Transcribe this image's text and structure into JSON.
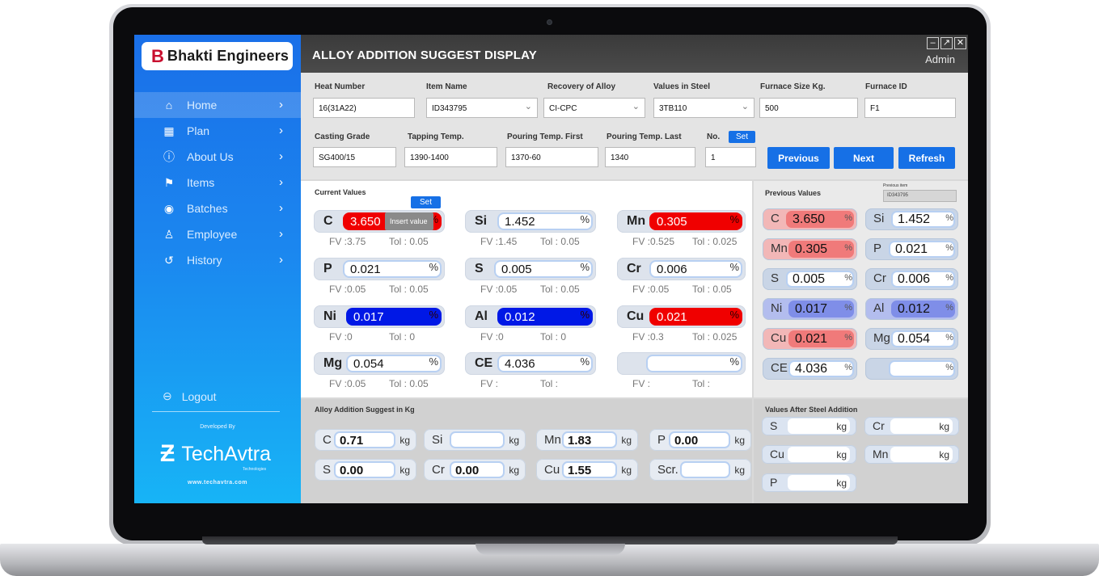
{
  "brand": {
    "b": "B",
    "name": "Bhakti Engineers"
  },
  "nav": [
    {
      "label": "Home",
      "icon": "home-icon",
      "glyph": "⌂"
    },
    {
      "label": "Plan",
      "icon": "plan-icon",
      "glyph": "▦"
    },
    {
      "label": "About Us",
      "icon": "info-icon",
      "glyph": "ⓘ"
    },
    {
      "label": "Items",
      "icon": "items-icon",
      "glyph": "⚑"
    },
    {
      "label": "Batches",
      "icon": "batches-icon",
      "glyph": "◉"
    },
    {
      "label": "Employee",
      "icon": "employee-icon",
      "glyph": "♙"
    },
    {
      "label": "History",
      "icon": "history-icon",
      "glyph": "↺"
    }
  ],
  "logout": "Logout",
  "developed_by": "Developed By",
  "techavtra": {
    "name": "TechAvtra",
    "sub": "Technologies",
    "web": "www.techavtra.com"
  },
  "header": {
    "title": "ALLOY ADDITION SUGGEST DISPLAY",
    "user": "Admin",
    "win": [
      "–",
      "↗",
      "✕"
    ]
  },
  "form": {
    "heat_number": {
      "label": "Heat Number",
      "value": "16(31A22)"
    },
    "item_name": {
      "label": "Item Name",
      "value": "ID343795"
    },
    "recovery": {
      "label": "Recovery of Alloy",
      "value": "CI-CPC"
    },
    "values_in_steel": {
      "label": "Values in Steel",
      "value": "3TB110"
    },
    "furnace_size": {
      "label": "Furnace Size Kg.",
      "value": "500"
    },
    "furnace_id": {
      "label": "Furnace ID",
      "value": "F1"
    },
    "casting_grade": {
      "label": "Casting Grade",
      "value": "SG400/15"
    },
    "tapping_temp": {
      "label": "Tapping Temp.",
      "value": "1390-1400"
    },
    "pour_first": {
      "label": "Pouring Temp. First",
      "value": "1370-60"
    },
    "pour_last": {
      "label": "Pouring Temp. Last",
      "value": "1340"
    },
    "no": {
      "label": "No.",
      "value": "1",
      "set": "Set"
    },
    "buttons": {
      "previous": "Previous",
      "next": "Next",
      "refresh": "Refresh"
    }
  },
  "current": {
    "title": "Current Values",
    "set": "Set",
    "tooltip": "Insert value",
    "rows": [
      [
        {
          "sym": "C",
          "val": "3.650",
          "state": "red",
          "fv": "FV :3.75",
          "tol": "Tol : 0.05"
        },
        {
          "sym": "Si",
          "val": "1.452",
          "state": "",
          "fv": "FV :1.45",
          "tol": "Tol : 0.05"
        },
        {
          "sym": "Mn",
          "val": "0.305",
          "state": "red",
          "fv": "FV :0.525",
          "tol": "Tol : 0.025"
        }
      ],
      [
        {
          "sym": "P",
          "val": "0.021",
          "state": "",
          "fv": "FV :0.05",
          "tol": "Tol : 0.05"
        },
        {
          "sym": "S",
          "val": "0.005",
          "state": "",
          "fv": "FV :0.05",
          "tol": "Tol : 0.05"
        },
        {
          "sym": "Cr",
          "val": "0.006",
          "state": "",
          "fv": "FV :0.05",
          "tol": "Tol : 0.05"
        }
      ],
      [
        {
          "sym": "Ni",
          "val": "0.017",
          "state": "blue",
          "fv": "FV :0",
          "tol": "Tol : 0"
        },
        {
          "sym": "Al",
          "val": "0.012",
          "state": "blue",
          "fv": "FV :0",
          "tol": "Tol : 0"
        },
        {
          "sym": "Cu",
          "val": "0.021",
          "state": "red",
          "fv": "FV :0.3",
          "tol": "Tol : 0.025"
        }
      ],
      [
        {
          "sym": "Mg",
          "val": "0.054",
          "state": "",
          "fv": "FV :0.05",
          "tol": "Tol : 0.05"
        },
        {
          "sym": "CE",
          "val": "4.036",
          "state": "",
          "fv": "FV :",
          "tol": "Tol :"
        },
        {
          "sym": "",
          "val": "",
          "state": "",
          "fv": "FV :",
          "tol": "Tol :"
        }
      ]
    ]
  },
  "previous": {
    "title": "Previous Values",
    "prev_item_label": "Previous item",
    "prev_item_value": "ID343795",
    "items": [
      {
        "sym": "C",
        "val": "3.650",
        "state": "red"
      },
      {
        "sym": "Si",
        "val": "1.452",
        "state": ""
      },
      {
        "sym": "Mn",
        "val": "0.305",
        "state": "red"
      },
      {
        "sym": "P",
        "val": "0.021",
        "state": ""
      },
      {
        "sym": "S",
        "val": "0.005",
        "state": ""
      },
      {
        "sym": "Cr",
        "val": "0.006",
        "state": ""
      },
      {
        "sym": "Ni",
        "val": "0.017",
        "state": "blue"
      },
      {
        "sym": "Al",
        "val": "0.012",
        "state": "blue"
      },
      {
        "sym": "Cu",
        "val": "0.021",
        "state": "red"
      },
      {
        "sym": "Mg",
        "val": "0.054",
        "state": ""
      },
      {
        "sym": "CE",
        "val": "4.036",
        "state": ""
      },
      {
        "sym": "",
        "val": "",
        "state": ""
      }
    ]
  },
  "alloy": {
    "title": "Alloy Addition Suggest in Kg",
    "unit": "kg",
    "items": [
      {
        "sym": "C",
        "val": "0.71"
      },
      {
        "sym": "Si",
        "val": ""
      },
      {
        "sym": "Mn",
        "val": "1.83"
      },
      {
        "sym": "P",
        "val": "0.00"
      },
      {
        "sym": "S",
        "val": "0.00"
      },
      {
        "sym": "Cr",
        "val": "0.00"
      },
      {
        "sym": "Cu",
        "val": "1.55"
      },
      {
        "sym": "Scr.",
        "val": ""
      }
    ]
  },
  "after": {
    "title": "Values After Steel Addition",
    "unit": "kg",
    "items": [
      {
        "sym": "S"
      },
      {
        "sym": "Cr"
      },
      {
        "sym": "Cu"
      },
      {
        "sym": "Mn"
      },
      {
        "sym": "P"
      }
    ]
  },
  "colors": {
    "accent": "#1670e6",
    "alert_red": "#f00000",
    "alert_blue": "#0018e6"
  }
}
